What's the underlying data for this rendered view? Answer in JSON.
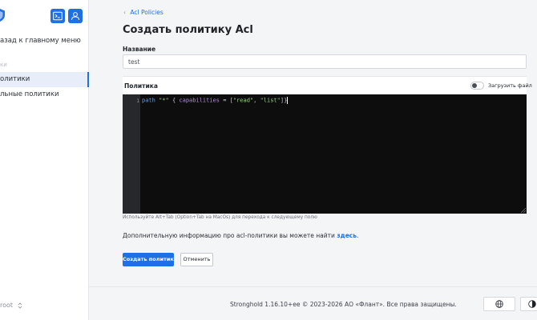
{
  "sidebar": {
    "back_to_menu": "азад к главному меню",
    "section_label": "ки",
    "items": [
      {
        "label": "олитики",
        "active": true
      },
      {
        "label": "льные политики",
        "active": false
      }
    ],
    "user": "root",
    "icons": [
      "shield-icon",
      "terminal-icon",
      "user-icon",
      "updown-chevron-icon"
    ]
  },
  "breadcrumb": {
    "label": "Acl Policies"
  },
  "page_title": "Создать политику Acl",
  "form": {
    "name_label": "Название",
    "name_value": "test",
    "policy_label": "Политика",
    "upload_toggle_label": "Загрузить файл",
    "upload_toggle_on": false
  },
  "editor": {
    "line_number": "1",
    "code_tokens": {
      "kw_path": "path",
      "path_value": "\"*\"",
      "brace_open": "{",
      "ident": "capabilities",
      "eq": "=",
      "bracket_open": "[",
      "cap1": "\"read\"",
      "comma": ",",
      "cap2": "\"list\"",
      "bracket_close": "]",
      "brace_close": "}"
    }
  },
  "hint": "Используйте Alt+Tab (Option+Tab на MacOs) для перехода к следующему полю",
  "info": {
    "text": "Дополнительную информацию про acl-политики вы можете найти ",
    "link": "здесь",
    "suffix": "."
  },
  "buttons": {
    "create": "Создать политику",
    "cancel": "Отменить"
  },
  "footer": {
    "text": "Stronghold 1.16.10+ee   © 2023-2026 АО «Флант». Все права защищены."
  },
  "colors": {
    "accent": "#1f6fe5",
    "editor_bg": "#0d0d0e",
    "page_bg": "#f4f5f7"
  }
}
